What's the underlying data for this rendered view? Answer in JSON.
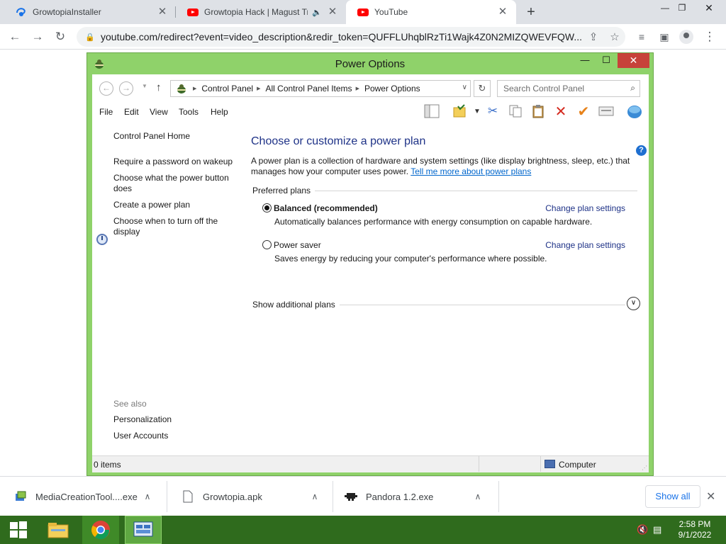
{
  "browser": {
    "tabs": [
      {
        "title": "GrowtopiaInstaller",
        "favicon": "edge-download-icon"
      },
      {
        "title": "Growtopia Hack | Magust Tra",
        "favicon": "youtube-icon",
        "audio": true
      },
      {
        "title": "YouTube",
        "favicon": "youtube-icon",
        "active": true
      }
    ],
    "url": "youtube.com/redirect?event=video_description&redir_token=QUFFLUhqblRzTi1Wajk4Z0N2MIZQWEVFQW..."
  },
  "window": {
    "title": "Power Options",
    "breadcrumbs": [
      "Control Panel",
      "All Control Panel Items",
      "Power Options"
    ],
    "search_placeholder": "Search Control Panel",
    "menus": [
      "File",
      "Edit",
      "View",
      "Tools",
      "Help"
    ],
    "left_links": {
      "home": "Control Panel Home",
      "password": "Require a password on wakeup",
      "power_button": "Choose what the power button does",
      "create_plan": "Create a power plan",
      "turn_off_display": "Choose when to turn off the display"
    },
    "see_also": {
      "heading": "See also",
      "items": [
        "Personalization",
        "User Accounts"
      ]
    },
    "main": {
      "title": "Choose or customize a power plan",
      "intro": "A power plan is a collection of hardware and system settings (like display brightness, sleep, etc.) that manages how your computer uses power.",
      "intro_link": "Tell me more about power plans",
      "preferred_heading": "Preferred plans",
      "plans": [
        {
          "name": "Balanced (recommended)",
          "desc": "Automatically balances performance with energy consumption on capable hardware.",
          "link": "Change plan settings",
          "selected": true
        },
        {
          "name": "Power saver",
          "desc": "Saves energy by reducing your computer's performance where possible.",
          "link": "Change plan settings",
          "selected": false
        }
      ],
      "additional": "Show additional plans"
    },
    "status": {
      "items": "0 items",
      "location": "Computer"
    }
  },
  "downloads": {
    "items": [
      "MediaCreationTool....exe",
      "Growtopia.apk",
      "Pandora 1.2.exe"
    ],
    "show_all": "Show all"
  },
  "taskbar": {
    "time": "2:58 PM",
    "date": "9/1/2022"
  },
  "colors": {
    "window_frame": "#8fd26a",
    "link_blue": "#1e3287",
    "taskbar": "#2f6b1d"
  }
}
